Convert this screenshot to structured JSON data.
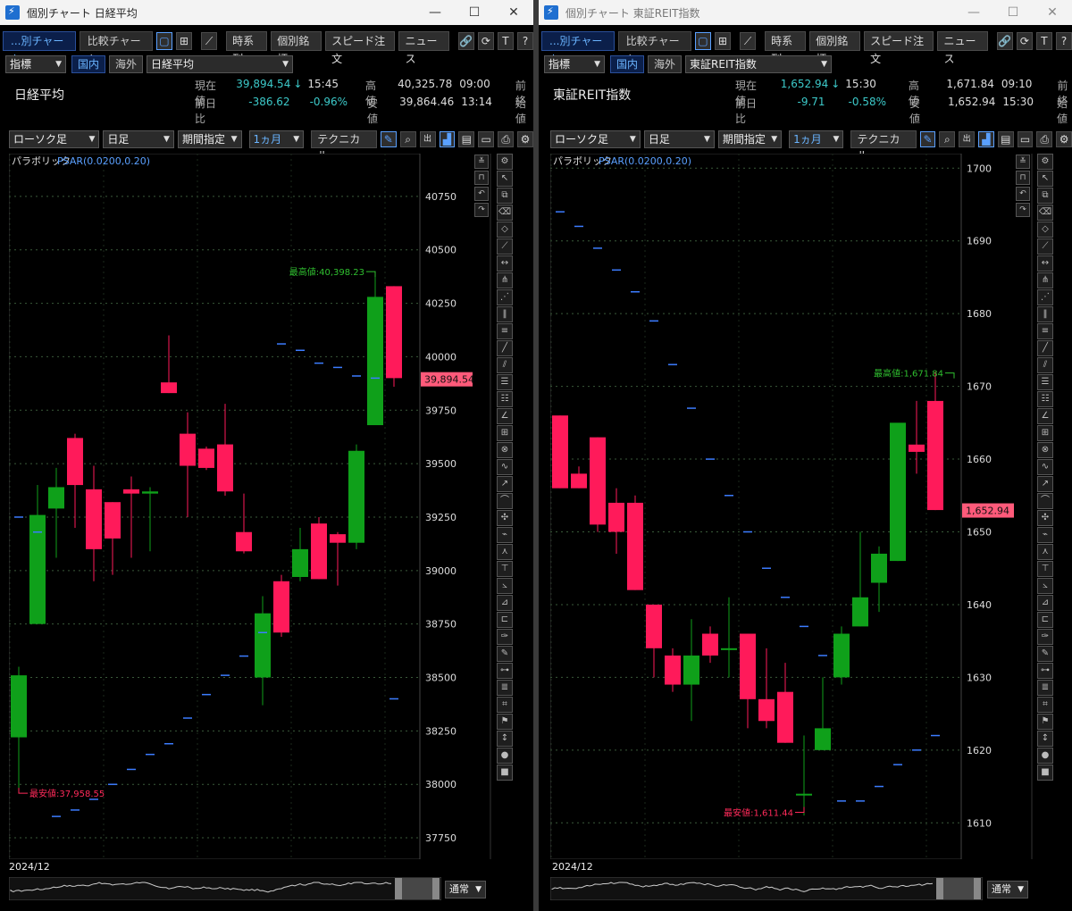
{
  "windows": [
    {
      "id": "left",
      "title": "個別チャート 日経平均",
      "tabs": [
        "...別チャート",
        "比較チャート"
      ],
      "toolbar": [
        "時系列",
        "個別銘柄",
        "スピード注文",
        "ニュース"
      ],
      "indicator_select": "指標",
      "market_tabs": [
        "国内",
        "海外"
      ],
      "instrument_select": "日経平均",
      "instrument_name": "日経平均",
      "quote": {
        "current_label": "現在値",
        "current": "39,894.54",
        "arrow": "↓",
        "current_time": "15:45",
        "change_label": "前日比",
        "change": "-386.62",
        "change_pct": "-0.96%",
        "high_label": "高値",
        "high": "40,325.78",
        "high_time": "09:00",
        "low_label": "安値",
        "low": "39,864.46",
        "low_time": "13:14",
        "prev_label": "前終",
        "open_label": "始値"
      },
      "chart_controls": [
        "ローソク足",
        "日足",
        "期間指定",
        "1ヵ月",
        "テクニカル"
      ],
      "indicator_label": "パラボリック",
      "indicator_params": "PSAR(0.0200,0.20)",
      "date_label": "2024/12",
      "mode_select": "通常",
      "chart_data": {
        "type": "candlestick",
        "ylim": [
          37650,
          40950
        ],
        "yticks": [
          40750,
          40500,
          40250,
          40000,
          39750,
          39500,
          39250,
          39000,
          38750,
          38500,
          38250,
          38000,
          37750
        ],
        "ytick_labels": [
          "40750",
          "40500",
          "40250",
          "40000",
          "39750",
          "39500",
          "39250",
          "39000",
          "38750",
          "38500",
          "38250",
          "38000",
          "37750"
        ],
        "current_price": 39894.54,
        "current_label": "39,894.54",
        "max_label": "最高値:40,398.23",
        "max_value": 40398.23,
        "max_index": 19,
        "min_label": "最安値:37,958.55",
        "min_value": 37958.55,
        "min_index": 0,
        "candles": [
          {
            "o": 38220,
            "h": 38550,
            "l": 37958,
            "c": 38510
          },
          {
            "o": 38750,
            "h": 39400,
            "l": 38750,
            "c": 39260
          },
          {
            "o": 39290,
            "h": 39480,
            "l": 39060,
            "c": 39390
          },
          {
            "o": 39620,
            "h": 39640,
            "l": 39200,
            "c": 39400
          },
          {
            "o": 39380,
            "h": 39490,
            "l": 38950,
            "c": 39100
          },
          {
            "o": 39320,
            "h": 39320,
            "l": 38980,
            "c": 39150
          },
          {
            "o": 39380,
            "h": 39440,
            "l": 39060,
            "c": 39360
          },
          {
            "o": 39360,
            "h": 39390,
            "l": 39090,
            "c": 39370
          },
          {
            "o": 39880,
            "h": 40100,
            "l": 39830,
            "c": 39830
          },
          {
            "o": 39640,
            "h": 39740,
            "l": 39250,
            "c": 39490
          },
          {
            "o": 39570,
            "h": 39580,
            "l": 39470,
            "c": 39480
          },
          {
            "o": 39590,
            "h": 39780,
            "l": 39350,
            "c": 39370
          },
          {
            "o": 39180,
            "h": 39360,
            "l": 39080,
            "c": 39090
          },
          {
            "o": 38500,
            "h": 38880,
            "l": 38370,
            "c": 38800
          },
          {
            "o": 38950,
            "h": 38980,
            "l": 38690,
            "c": 38710
          },
          {
            "o": 38970,
            "h": 39200,
            "l": 38950,
            "c": 39100
          },
          {
            "o": 39220,
            "h": 39250,
            "l": 38960,
            "c": 38960
          },
          {
            "o": 39170,
            "h": 39180,
            "l": 38930,
            "c": 39130
          },
          {
            "o": 39130,
            "h": 39590,
            "l": 39100,
            "c": 39560
          },
          {
            "o": 39680,
            "h": 40400,
            "l": 39680,
            "c": 40280
          },
          {
            "o": 40330,
            "h": 40330,
            "l": 39860,
            "c": 39900
          }
        ],
        "psar": [
          {
            "i": 0,
            "v": 39250
          },
          {
            "i": 1,
            "v": 39180
          },
          {
            "i": 2,
            "v": 37850
          },
          {
            "i": 3,
            "v": 37880
          },
          {
            "i": 4,
            "v": 37930
          },
          {
            "i": 5,
            "v": 38000
          },
          {
            "i": 6,
            "v": 38070
          },
          {
            "i": 7,
            "v": 38140
          },
          {
            "i": 8,
            "v": 38190
          },
          {
            "i": 9,
            "v": 38310
          },
          {
            "i": 10,
            "v": 38420
          },
          {
            "i": 11,
            "v": 38510
          },
          {
            "i": 12,
            "v": 38600
          },
          {
            "i": 13,
            "v": 38710
          },
          {
            "i": 14,
            "v": 40060
          },
          {
            "i": 15,
            "v": 40030
          },
          {
            "i": 16,
            "v": 39970
          },
          {
            "i": 17,
            "v": 39950
          },
          {
            "i": 18,
            "v": 39910
          },
          {
            "i": 19,
            "v": 39900
          },
          {
            "i": 20,
            "v": 38400
          }
        ]
      }
    },
    {
      "id": "right",
      "title": "個別チャート 東証REIT指数",
      "tabs": [
        "...別チャート",
        "比較チャート"
      ],
      "toolbar": [
        "時系列",
        "個別銘柄",
        "スピード注文",
        "ニュース"
      ],
      "indicator_select": "指標",
      "market_tabs": [
        "国内",
        "海外"
      ],
      "instrument_select": "東証REIT指数",
      "instrument_name": "東証REIT指数",
      "quote": {
        "current_label": "現在値",
        "current": "1,652.94",
        "arrow": "↓",
        "current_time": "15:30",
        "change_label": "前日比",
        "change": "-9.71",
        "change_pct": "-0.58%",
        "high_label": "高値",
        "high": "1,671.84",
        "high_time": "09:10",
        "low_label": "安値",
        "low": "1,652.94",
        "low_time": "15:30",
        "prev_label": "前終",
        "open_label": "始値"
      },
      "chart_controls": [
        "ローソク足",
        "日足",
        "期間指定",
        "1ヵ月",
        "テクニカル"
      ],
      "indicator_label": "パラボリック",
      "indicator_params": "PSAR(0.0200,0.20)",
      "date_label": "2024/12",
      "mode_select": "通常",
      "chart_data": {
        "type": "candlestick",
        "ylim": [
          1605,
          1702
        ],
        "yticks": [
          1700,
          1690,
          1680,
          1670,
          1660,
          1650,
          1640,
          1630,
          1620,
          1610
        ],
        "ytick_labels": [
          "1700",
          "1690",
          "1680",
          "1670",
          "1660",
          "1650",
          "1640",
          "1630",
          "1620",
          "1610"
        ],
        "current_price": 1652.94,
        "current_label": "1,652.94",
        "max_label": "最高値:1,671.84",
        "max_value": 1671.84,
        "max_index": 21,
        "min_label": "最安値:1,611.44",
        "min_value": 1611.44,
        "min_index": 13,
        "candles": [
          {
            "o": 1666,
            "h": 1666,
            "l": 1656,
            "c": 1656
          },
          {
            "o": 1658,
            "h": 1659,
            "l": 1656,
            "c": 1656
          },
          {
            "o": 1663,
            "h": 1663,
            "l": 1650,
            "c": 1651
          },
          {
            "o": 1654,
            "h": 1656,
            "l": 1647,
            "c": 1650
          },
          {
            "o": 1654,
            "h": 1655,
            "l": 1642,
            "c": 1642
          },
          {
            "o": 1640,
            "h": 1640,
            "l": 1630,
            "c": 1634
          },
          {
            "o": 1633,
            "h": 1634,
            "l": 1628,
            "c": 1629
          },
          {
            "o": 1629,
            "h": 1638,
            "l": 1624,
            "c": 1633
          },
          {
            "o": 1636,
            "h": 1637,
            "l": 1632,
            "c": 1633
          },
          {
            "o": 1634,
            "h": 1641,
            "l": 1630,
            "c": 1634
          },
          {
            "o": 1636,
            "h": 1636,
            "l": 1623,
            "c": 1627
          },
          {
            "o": 1627,
            "h": 1634,
            "l": 1623,
            "c": 1624
          },
          {
            "o": 1628,
            "h": 1632,
            "l": 1621,
            "c": 1621
          },
          {
            "o": 1614,
            "h": 1622,
            "l": 1611,
            "c": 1614
          },
          {
            "o": 1620,
            "h": 1630,
            "l": 1620,
            "c": 1623
          },
          {
            "o": 1630,
            "h": 1637,
            "l": 1629,
            "c": 1636
          },
          {
            "o": 1637,
            "h": 1650,
            "l": 1637,
            "c": 1641
          },
          {
            "o": 1643,
            "h": 1648,
            "l": 1639,
            "c": 1647
          },
          {
            "o": 1646,
            "h": 1663,
            "l": 1646,
            "c": 1665
          },
          {
            "o": 1662,
            "h": 1668,
            "l": 1658,
            "c": 1661
          },
          {
            "o": 1668,
            "h": 1672,
            "l": 1653,
            "c": 1653
          }
        ],
        "psar": [
          {
            "i": 0,
            "v": 1694
          },
          {
            "i": 1,
            "v": 1692
          },
          {
            "i": 2,
            "v": 1689
          },
          {
            "i": 3,
            "v": 1686
          },
          {
            "i": 4,
            "v": 1683
          },
          {
            "i": 5,
            "v": 1679
          },
          {
            "i": 6,
            "v": 1673
          },
          {
            "i": 7,
            "v": 1667
          },
          {
            "i": 8,
            "v": 1660
          },
          {
            "i": 9,
            "v": 1655
          },
          {
            "i": 10,
            "v": 1650
          },
          {
            "i": 11,
            "v": 1645
          },
          {
            "i": 12,
            "v": 1641
          },
          {
            "i": 13,
            "v": 1637
          },
          {
            "i": 14,
            "v": 1633
          },
          {
            "i": 15,
            "v": 1613
          },
          {
            "i": 16,
            "v": 1613
          },
          {
            "i": 17,
            "v": 1615
          },
          {
            "i": 18,
            "v": 1618
          },
          {
            "i": 19,
            "v": 1620
          },
          {
            "i": 20,
            "v": 1622
          }
        ]
      }
    }
  ],
  "icons": {
    "layout_single": "square-icon",
    "layout_grid": "grid-icon",
    "draw": "pen-icon",
    "link": "link-icon",
    "refresh": "refresh-icon",
    "text": "text-icon",
    "help": "help-icon"
  },
  "colors": {
    "up": "#0fa01a",
    "down": "#ff1a5a",
    "psar": "#3c7cff",
    "grid": "#3a5a3a",
    "max_label": "#2fbf2f",
    "min_label": "#ff2a5a",
    "price_tag": "#ff5a7a"
  }
}
